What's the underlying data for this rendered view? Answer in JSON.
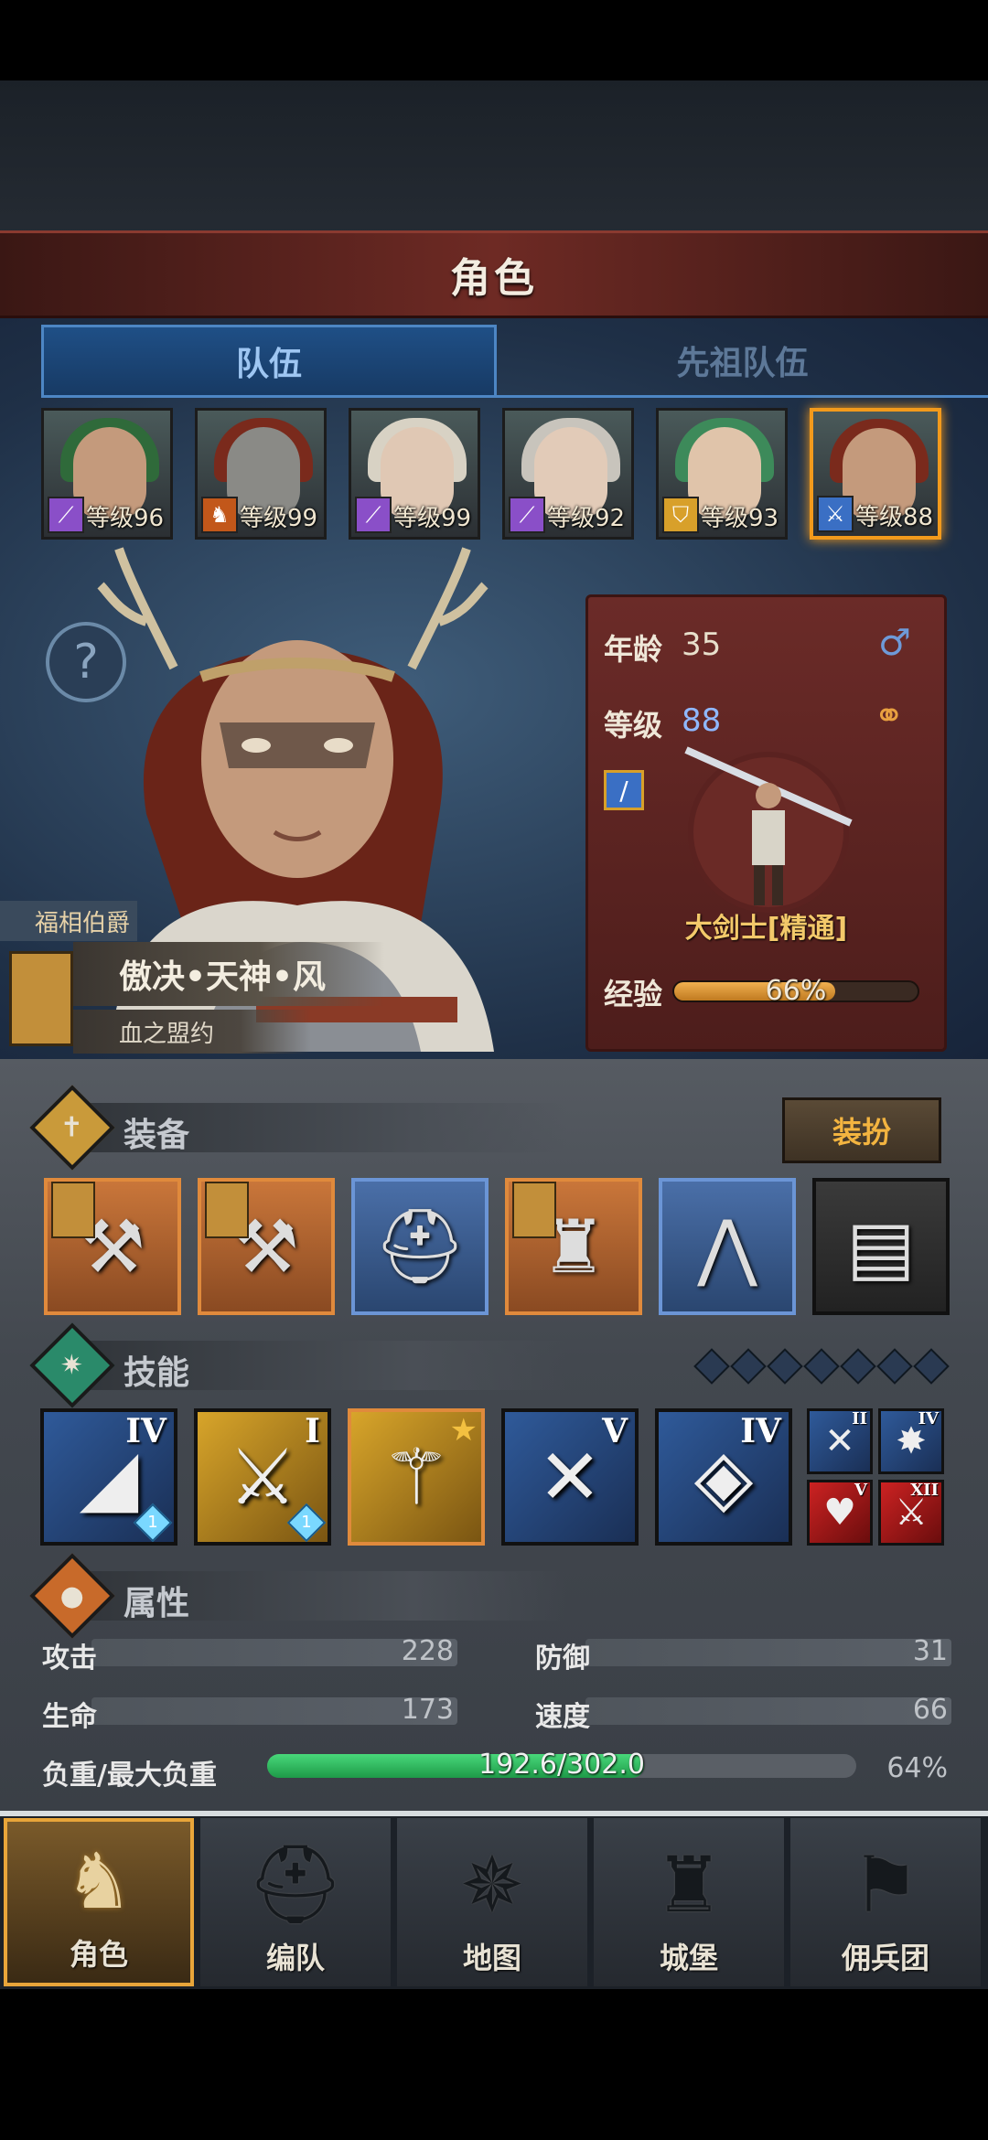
{
  "header": {
    "title": "角色"
  },
  "tabs": [
    {
      "label": "队伍",
      "active": true
    },
    {
      "label": "先祖队伍",
      "active": false
    }
  ],
  "party": [
    {
      "level": "等级96",
      "class_icon": "staff-icon",
      "class_color": "#8a4fc8",
      "hair": "#2f6a3a",
      "skin": "#c49a7c"
    },
    {
      "level": "等级99",
      "class_icon": "beast-icon",
      "class_color": "#c2571a",
      "hair": "#7a2a1c",
      "skin": "#8a8a86"
    },
    {
      "level": "等级99",
      "class_icon": "staff-icon",
      "class_color": "#8a4fc8",
      "hair": "#d8d2c4",
      "skin": "#e0c8b4"
    },
    {
      "level": "等级92",
      "class_icon": "staff-icon",
      "class_color": "#8a4fc8",
      "hair": "#c8c4bc",
      "skin": "#e2cbb8"
    },
    {
      "level": "等级93",
      "class_icon": "shield-icon",
      "class_color": "#d8a02a",
      "hair": "#3d8a5a",
      "skin": "#e0c4aa"
    },
    {
      "level": "等级88",
      "class_icon": "sword-icon",
      "class_color": "#3a6fc4",
      "hair": "#7a2a1c",
      "skin": "#c49a7c",
      "selected": true
    }
  ],
  "character": {
    "noble_title": "福相伯爵",
    "name": "傲决•天神•风",
    "pact": "血之盟约",
    "age_label": "年龄",
    "age": "35",
    "level_label": "等级",
    "level": "88",
    "class_name": "大剑士[精通]",
    "exp_label": "经验",
    "exp_percent": "66%",
    "exp_fraction": 0.66
  },
  "equipment": {
    "label": "装备",
    "dress_button": "装扮",
    "items": [
      {
        "icon": "halberd-icon",
        "rarity": "orange",
        "flag": true
      },
      {
        "icon": "halberd-icon",
        "rarity": "orange",
        "flag": true
      },
      {
        "icon": "helmet-icon",
        "rarity": "blue",
        "flag": false
      },
      {
        "icon": "fur-armor-icon",
        "rarity": "orange",
        "flag": true
      },
      {
        "icon": "boots-icon",
        "rarity": "blue",
        "flag": false
      },
      {
        "icon": "book-icon",
        "rarity": "dark",
        "flag": false
      }
    ]
  },
  "skills": {
    "label": "技能",
    "main": [
      {
        "icon": "blade-strike-icon",
        "rank": "IV",
        "style": "blue",
        "gem": "1"
      },
      {
        "icon": "twin-swords-icon",
        "rank": "I",
        "style": "gold",
        "gem": "1"
      },
      {
        "icon": "sword-aura-icon",
        "rank": "",
        "style": "gold",
        "selected": true,
        "star": true
      },
      {
        "icon": "crossed-swords-icon",
        "rank": "V",
        "style": "blue"
      },
      {
        "icon": "crystal-icon",
        "rank": "IV",
        "style": "blue"
      }
    ],
    "mini": [
      {
        "icon": "crossed-blades-icon",
        "rank": "II",
        "style": "blue"
      },
      {
        "icon": "burst-icon",
        "rank": "IV",
        "style": "blue"
      },
      {
        "icon": "heartbeat-icon",
        "rank": "V",
        "style": "red"
      },
      {
        "icon": "sword-red-icon",
        "rank": "XII",
        "style": "red"
      }
    ]
  },
  "attributes": {
    "label": "属性",
    "attack_label": "攻击",
    "attack": "228",
    "defense_label": "防御",
    "defense": "31",
    "hp_label": "生命",
    "hp": "173",
    "speed_label": "速度",
    "speed": "66",
    "load_label": "负重/最大负重",
    "load": "192.6/302.0",
    "load_percent": "64%",
    "load_fraction": 0.64
  },
  "nav": [
    {
      "label": "角色",
      "icon": "knight-icon",
      "active": true
    },
    {
      "label": "编队",
      "icon": "helmet-icon"
    },
    {
      "label": "地图",
      "icon": "compass-icon"
    },
    {
      "label": "城堡",
      "icon": "castle-icon"
    },
    {
      "label": "佣兵团",
      "icon": "mercenary-icon"
    }
  ]
}
